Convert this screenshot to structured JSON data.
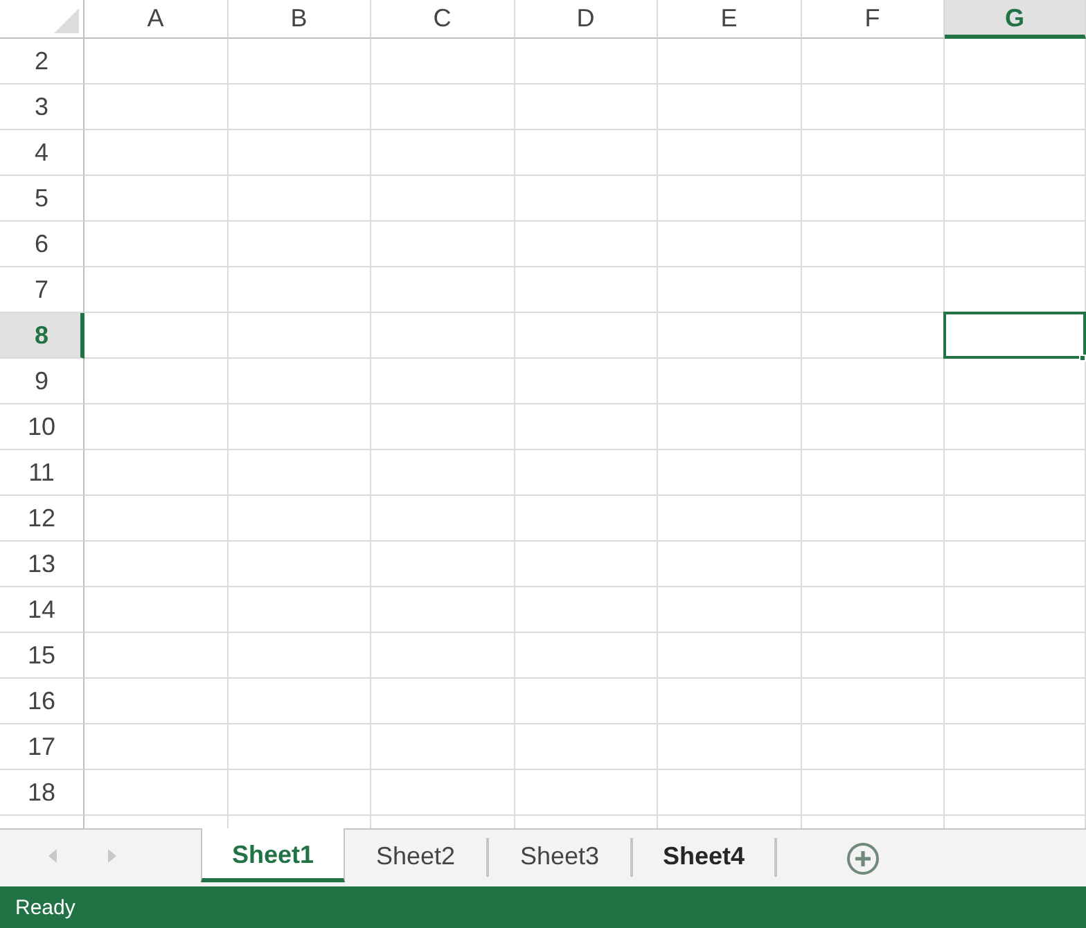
{
  "columns": [
    {
      "label": "A",
      "selected": false
    },
    {
      "label": "B",
      "selected": false
    },
    {
      "label": "C",
      "selected": false
    },
    {
      "label": "D",
      "selected": false
    },
    {
      "label": "E",
      "selected": false
    },
    {
      "label": "F",
      "selected": false
    },
    {
      "label": "G",
      "selected": true
    }
  ],
  "rows": [
    {
      "label": "2",
      "selected": false
    },
    {
      "label": "3",
      "selected": false
    },
    {
      "label": "4",
      "selected": false
    },
    {
      "label": "5",
      "selected": false
    },
    {
      "label": "6",
      "selected": false
    },
    {
      "label": "7",
      "selected": false
    },
    {
      "label": "8",
      "selected": true
    },
    {
      "label": "9",
      "selected": false
    },
    {
      "label": "10",
      "selected": false
    },
    {
      "label": "11",
      "selected": false
    },
    {
      "label": "12",
      "selected": false
    },
    {
      "label": "13",
      "selected": false
    },
    {
      "label": "14",
      "selected": false
    },
    {
      "label": "15",
      "selected": false
    },
    {
      "label": "16",
      "selected": false
    },
    {
      "label": "17",
      "selected": false
    },
    {
      "label": "18",
      "selected": false
    }
  ],
  "sheet_nav": [
    {
      "kind": "previous",
      "disabled": true
    },
    {
      "kind": "next",
      "disabled": true
    }
  ],
  "sheet_tabs": [
    {
      "label": "Sheet1",
      "active": true,
      "selected": true
    },
    {
      "label": "Sheet2",
      "active": false,
      "selected": false
    },
    {
      "label": "Sheet3",
      "active": false,
      "selected": false
    },
    {
      "label": "Sheet4",
      "active": false,
      "selected": true
    }
  ],
  "status_bar": {
    "text": "Ready"
  }
}
